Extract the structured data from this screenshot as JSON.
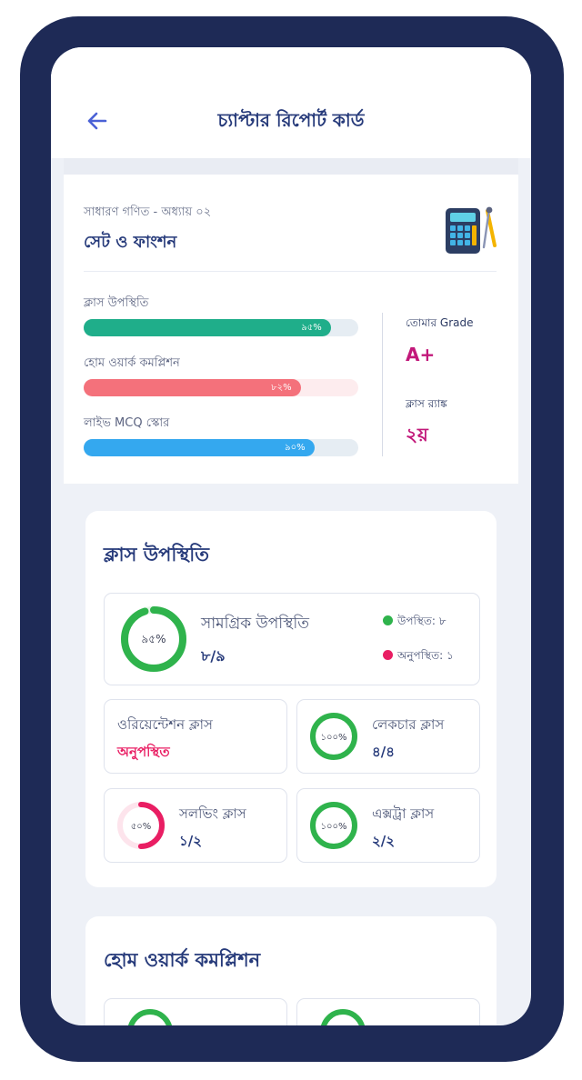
{
  "header": {
    "title": "চ্যাপ্টার রিপোর্ট কার্ড"
  },
  "subject": {
    "subtitle": "সাধারণ গণিত - অধ্যায় ০২",
    "title": "সেট ও ফাংশন"
  },
  "progress": [
    {
      "label": "ক্লাস উপস্থিতি",
      "percent_text": "৯৫%",
      "fraction": 0.9,
      "color": "#1fae8a",
      "track": "#e6edf3"
    },
    {
      "label": "হোম ওয়ার্ক কমপ্লিশন",
      "percent_text": "৮২%",
      "fraction": 0.79,
      "color": "#f4717b",
      "track": "#fdecee"
    },
    {
      "label": "লাইভ MCQ স্কোর",
      "percent_text": "৯০%",
      "fraction": 0.84,
      "color": "#34a8ef",
      "track": "#e6edf3"
    }
  ],
  "grade": {
    "label": "তোমার Grade",
    "value": "A+"
  },
  "rank": {
    "label": "ক্লাস র‍্যাঙ্ক",
    "value": "২য়"
  },
  "attendance": {
    "title": "ক্লাস উপস্থিতি",
    "overall": {
      "percent_text": "৯৫%",
      "fraction": 0.95,
      "label": "সামগ্রিক উপস্থিতি",
      "value": "৮/৯"
    },
    "legend": {
      "present": "উপস্থিত: ৮",
      "absent": "অনুপস্থিত: ১"
    },
    "orientation": {
      "label": "ওরিয়েন্টেশন ক্লাস",
      "value": "অনুপস্থিত"
    },
    "lecture": {
      "percent_text": "১০০%",
      "fraction": 1,
      "label": "লেকচার ক্লাস",
      "value": "৪/৪"
    },
    "solving": {
      "percent_text": "৫০%",
      "fraction": 0.5,
      "label": "সলভিং ক্লাস",
      "value": "১/২"
    },
    "extra": {
      "percent_text": "১০০%",
      "fraction": 1,
      "label": "এক্সট্রা ক্লাস",
      "value": "২/২"
    }
  },
  "homework": {
    "title": "হোম ওয়ার্ক কমপ্লিশন"
  },
  "colors": {
    "accent": "#263a7a",
    "green": "#2fb34c",
    "pink": "#e91e63",
    "grade": "#c2187a"
  }
}
